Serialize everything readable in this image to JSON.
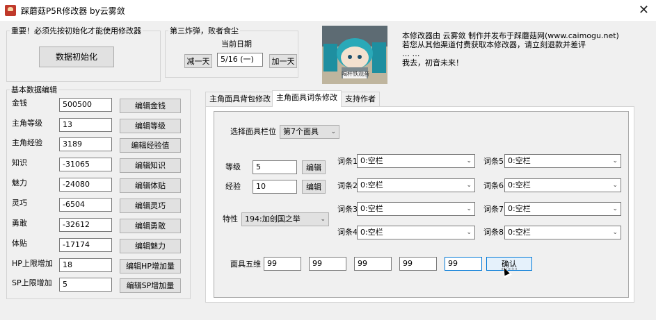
{
  "window": {
    "title": "踩蘑菇P5R修改器 by云雾敛",
    "close_glyph": "✕"
  },
  "init_group": {
    "legend": "重要！必须先按初始化才能使用修改器",
    "button": "数据初始化"
  },
  "date_group": {
    "legend": "第三炸弹，败者食尘",
    "label": "当前日期",
    "minus": "减一天",
    "value": "5/16 (一)",
    "plus": "加一天"
  },
  "photo": {
    "caption": "喝杯铁观音"
  },
  "message": [
    "本修改器由 云雾敛 制作并发布于踩蘑菇网(www.caimogu.net)",
    "若您从其他渠道付费获取本修改器，请立刻退款并差评",
    "… …",
    "我去，初音未来！"
  ],
  "basic": {
    "legend": "基本数据编辑",
    "rows": [
      {
        "label": "金钱",
        "value": "500500",
        "button": "编辑金钱"
      },
      {
        "label": "主角等级",
        "value": "13",
        "button": "编辑等级"
      },
      {
        "label": "主角经验",
        "value": "3189",
        "button": "编辑经验值"
      },
      {
        "label": "知识",
        "value": "-31065",
        "button": "编辑知识"
      },
      {
        "label": "魅力",
        "value": "-24080",
        "button": "编辑体贴"
      },
      {
        "label": "灵巧",
        "value": "-6504",
        "button": "编辑灵巧"
      },
      {
        "label": "勇敢",
        "value": "-32612",
        "button": "编辑勇敢"
      },
      {
        "label": "体贴",
        "value": "-17174",
        "button": "编辑魅力"
      },
      {
        "label": "HP上限增加",
        "value": "18",
        "button": "编辑HP增加量"
      },
      {
        "label": "SP上限增加",
        "value": "5",
        "button": "编辑SP增加量"
      }
    ]
  },
  "tabs": [
    "主角面具背包修改",
    "主角面具词条修改",
    "支持作者"
  ],
  "mask": {
    "slot_label": "选择面具栏位",
    "slot_value": "第7个面具",
    "level_label": "等级",
    "level_value": "5",
    "level_button": "编辑",
    "exp_label": "经验",
    "exp_value": "10",
    "exp_button": "编辑",
    "trait_label": "特性",
    "trait_value": "194:加创国之举",
    "entries": [
      {
        "label": "词条1",
        "value": "0:空栏"
      },
      {
        "label": "词条2",
        "value": "0:空栏"
      },
      {
        "label": "词条3",
        "value": "0:空栏"
      },
      {
        "label": "词条4",
        "value": "0:空栏"
      },
      {
        "label": "词条5",
        "value": "0:空栏"
      },
      {
        "label": "词条6",
        "value": "0:空栏"
      },
      {
        "label": "词条7",
        "value": "0:空栏"
      },
      {
        "label": "词条8",
        "value": "0:空栏"
      }
    ],
    "stats_label": "面具五维",
    "stats": [
      "99",
      "99",
      "99",
      "99",
      "99"
    ],
    "confirm": "确认"
  },
  "icons": {
    "dropdown": "chevron-down-icon",
    "close": "close-icon"
  }
}
